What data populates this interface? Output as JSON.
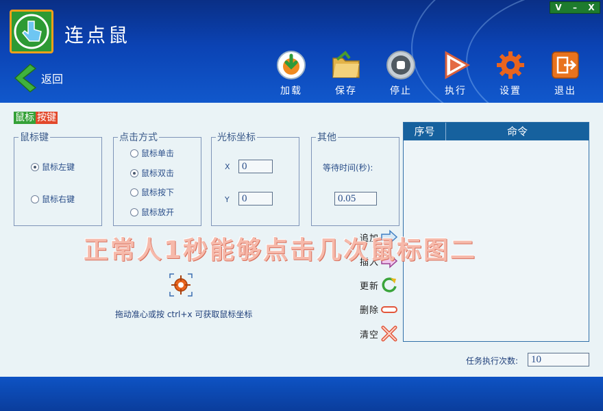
{
  "window": {
    "title": "连点鼠",
    "controls": [
      "V",
      "–",
      "X"
    ]
  },
  "nav": {
    "back_label": "返回"
  },
  "toolbar": [
    {
      "label": "加载",
      "icon": "load-icon"
    },
    {
      "label": "保存",
      "icon": "save-folder-icon"
    },
    {
      "label": "停止",
      "icon": "stop-icon"
    },
    {
      "label": "执行",
      "icon": "play-icon"
    },
    {
      "label": "设置",
      "icon": "gear-icon"
    },
    {
      "label": "退出",
      "icon": "exit-icon"
    }
  ],
  "section_tag": {
    "part1": "鼠标",
    "part2": "按键"
  },
  "mouse_key": {
    "legend": "鼠标键",
    "options": [
      "鼠标左键",
      "鼠标右键"
    ],
    "selected": "鼠标左键"
  },
  "click_mode": {
    "legend": "点击方式",
    "options": [
      "鼠标单击",
      "鼠标双击",
      "鼠标按下",
      "鼠标放开"
    ],
    "selected": "鼠标双击"
  },
  "cursor_coord": {
    "legend": "光标坐标",
    "x_label": "X",
    "x_value": "0",
    "y_label": "Y",
    "y_value": "0"
  },
  "other": {
    "legend": "其他",
    "wait_label": "等待时间(秒):",
    "wait_value": "0.05"
  },
  "watermark": "正常人1秒能够点击几次鼠标图二",
  "crosshair_hint": "拖动准心或按 ctrl+x 可获取鼠标坐标",
  "actions": [
    {
      "label": "追加",
      "icon": "append-arrow-icon"
    },
    {
      "label": "插入",
      "icon": "insert-arrow-icon"
    },
    {
      "label": "更新",
      "icon": "refresh-icon"
    },
    {
      "label": "删除",
      "icon": "delete-bar-icon"
    },
    {
      "label": "清空",
      "icon": "clear-x-icon"
    }
  ],
  "command_list": {
    "columns": [
      "序号",
      "命令"
    ],
    "rows": []
  },
  "repeat": {
    "label": "任务执行次数:",
    "value": "10"
  },
  "colors": {
    "header": "#0b43b4",
    "panel": "#eaf3f6",
    "list_header": "#16619e",
    "tag_green": "#35a138",
    "tag_red": "#e2482b"
  }
}
